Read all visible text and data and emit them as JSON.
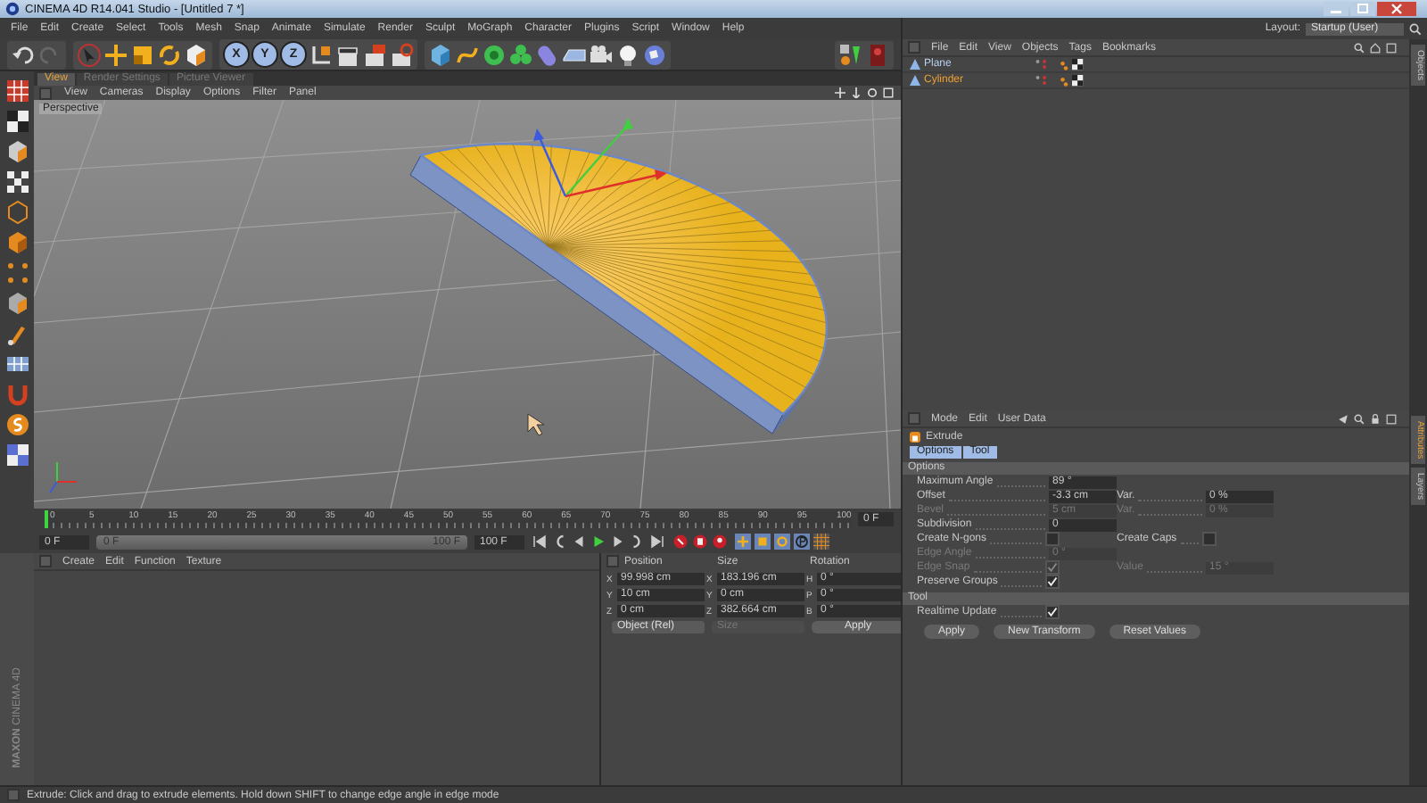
{
  "window": {
    "title": "CINEMA 4D R14.041 Studio - [Untitled 7 *]"
  },
  "menu": [
    "File",
    "Edit",
    "Create",
    "Select",
    "Tools",
    "Mesh",
    "Snap",
    "Animate",
    "Simulate",
    "Render",
    "Sculpt",
    "MoGraph",
    "Character",
    "Plugins",
    "Script",
    "Window",
    "Help"
  ],
  "layout": {
    "label": "Layout:",
    "value": "Startup (User)"
  },
  "toolbar": {
    "axis_locks": [
      {
        "label": "X",
        "on": true
      },
      {
        "label": "Y",
        "on": true
      },
      {
        "label": "Z",
        "on": true
      }
    ]
  },
  "viewport": {
    "tabs": [
      {
        "label": "View",
        "selected": true
      },
      {
        "label": "Render Settings",
        "selected": false
      },
      {
        "label": "Picture Viewer",
        "selected": false
      }
    ],
    "menu": [
      "View",
      "Cameras",
      "Display",
      "Options",
      "Filter",
      "Panel"
    ],
    "camera": "Perspective"
  },
  "timeline": {
    "ruler": [
      "0",
      "5",
      "10",
      "15",
      "20",
      "25",
      "30",
      "35",
      "40",
      "45",
      "50",
      "55",
      "60",
      "65",
      "70",
      "75",
      "80",
      "85",
      "90",
      "95",
      "100"
    ],
    "playhead": {
      "level": 0
    },
    "current_frame": "0 F",
    "start_field": "0 F",
    "range_start": "0 F",
    "range_end": "100 F",
    "range_bar": {
      "level": 1
    },
    "end_field": "100 F"
  },
  "materials": {
    "menu": [
      "Create",
      "Edit",
      "Function",
      "Texture"
    ],
    "logo": {
      "brand": "MAXON",
      "product": "CINEMA 4D"
    }
  },
  "coordinates": {
    "columns": [
      "Position",
      "Size",
      "Rotation"
    ],
    "rows": [
      [
        {
          "axis": "X",
          "value": "99.998 cm"
        },
        {
          "axis": "X",
          "value": "183.196 cm"
        },
        {
          "axis": "H",
          "value": "0 °"
        }
      ],
      [
        {
          "axis": "Y",
          "value": "10 cm"
        },
        {
          "axis": "Y",
          "value": "0 cm"
        },
        {
          "axis": "P",
          "value": "0 °"
        }
      ],
      [
        {
          "axis": "Z",
          "value": "0 cm"
        },
        {
          "axis": "Z",
          "value": "382.664 cm"
        },
        {
          "axis": "B",
          "value": "0 °"
        }
      ]
    ],
    "mode": {
      "value": "Object (Rel)",
      "disabled": false
    },
    "size_mode": {
      "value": "Size",
      "disabled": true
    },
    "apply": "Apply"
  },
  "objects": {
    "menu": [
      "File",
      "Edit",
      "View",
      "Objects",
      "Tags",
      "Bookmarks"
    ],
    "items": [
      {
        "name": "Plane",
        "selected": false
      },
      {
        "name": "Cylinder",
        "selected": true
      }
    ],
    "side_tabs": [
      "Objects"
    ]
  },
  "attributes": {
    "menu": [
      "Mode",
      "Edit",
      "User Data"
    ],
    "title": "Extrude",
    "tabs": [
      {
        "label": "Options",
        "selected": true
      },
      {
        "label": "Tool",
        "selected": true
      }
    ],
    "sections": [
      {
        "title": "Options",
        "rows": [
          [
            {
              "label": "Maximum Angle",
              "kind": "number",
              "value": "89 °",
              "disabled": false
            }
          ],
          [
            {
              "label": "Offset",
              "kind": "number",
              "value": "-3.3 cm",
              "disabled": false
            },
            {
              "label": "Var.",
              "kind": "number",
              "value": "0 %",
              "disabled": false
            }
          ],
          [
            {
              "label": "Bevel",
              "kind": "number",
              "value": "5 cm",
              "disabled": true
            },
            {
              "label": "Var.",
              "kind": "number",
              "value": "0 %",
              "disabled": true
            }
          ],
          [
            {
              "label": "Subdivision",
              "kind": "number",
              "value": "0",
              "disabled": false
            }
          ],
          [
            {
              "label": "Create N-gons",
              "kind": "checkbox",
              "checked": false,
              "disabled": false
            },
            {
              "label": "Create Caps",
              "kind": "checkbox",
              "checked": false,
              "disabled": false
            }
          ],
          [
            {
              "label": "Edge Angle",
              "kind": "number",
              "value": "0 °",
              "disabled": true
            }
          ],
          [
            {
              "label": "Edge Snap",
              "kind": "checkbox",
              "checked": true,
              "disabled": true
            },
            {
              "label": "Value",
              "kind": "number",
              "value": "15 °",
              "disabled": true
            }
          ],
          [
            {
              "label": "Preserve Groups",
              "kind": "checkbox",
              "checked": true,
              "disabled": false
            }
          ]
        ]
      },
      {
        "title": "Tool",
        "rows": [
          [
            {
              "label": "Realtime Update",
              "kind": "checkbox",
              "checked": true,
              "disabled": false
            }
          ]
        ]
      }
    ],
    "buttons": [
      "Apply",
      "New Transform",
      "Reset Values"
    ],
    "side_tabs": [
      "Attributes",
      "Layers"
    ]
  },
  "status_bar": "Extrude: Click and drag to extrude elements. Hold down SHIFT to change edge angle in edge mode"
}
